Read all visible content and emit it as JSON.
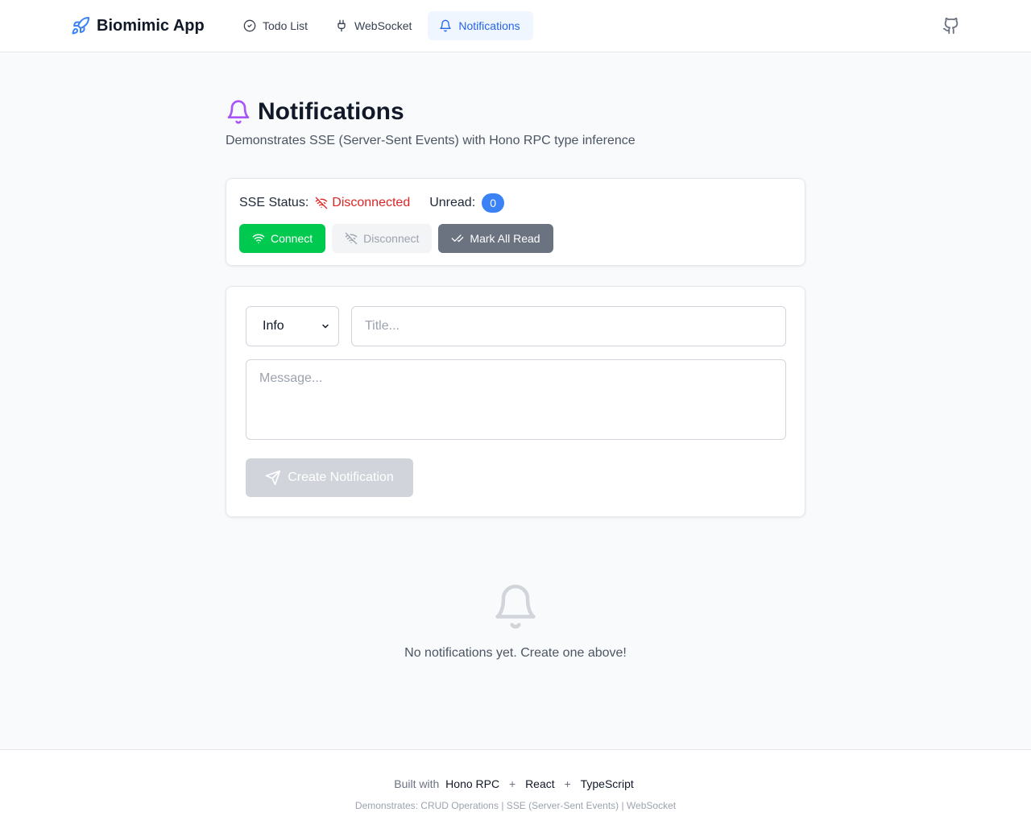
{
  "header": {
    "brand": "Biomimic App",
    "nav": [
      {
        "label": "Todo List",
        "icon": "circle-check-icon",
        "active": false
      },
      {
        "label": "WebSocket",
        "icon": "plug-icon",
        "active": false
      },
      {
        "label": "Notifications",
        "icon": "bell-icon",
        "active": true
      }
    ],
    "github_icon": "github-icon"
  },
  "page": {
    "title": "Notifications",
    "subtitle": "Demonstrates SSE (Server-Sent Events) with Hono RPC type inference"
  },
  "status": {
    "sse_label": "SSE Status:",
    "sse_value": "Disconnected",
    "unread_label": "Unread:",
    "unread_count": "0",
    "buttons": {
      "connect": "Connect",
      "disconnect": "Disconnect",
      "mark_all_read": "Mark All Read"
    }
  },
  "form": {
    "type_selected": "Info",
    "title_placeholder": "Title...",
    "message_placeholder": "Message...",
    "create_label": "Create Notification"
  },
  "empty": {
    "text": "No notifications yet. Create one above!"
  },
  "footer": {
    "built_with": "Built with",
    "tech": [
      "Hono RPC",
      "React",
      "TypeScript"
    ],
    "plus": "+",
    "demonstrates": "Demonstrates: CRUD Operations | SSE (Server-Sent Events) | WebSocket"
  },
  "colors": {
    "accent": "#2563eb",
    "disconnected": "#dc2626",
    "connect_button": "#00c950",
    "bell_purple": "#a855f7",
    "badge": "#3b82f6"
  }
}
